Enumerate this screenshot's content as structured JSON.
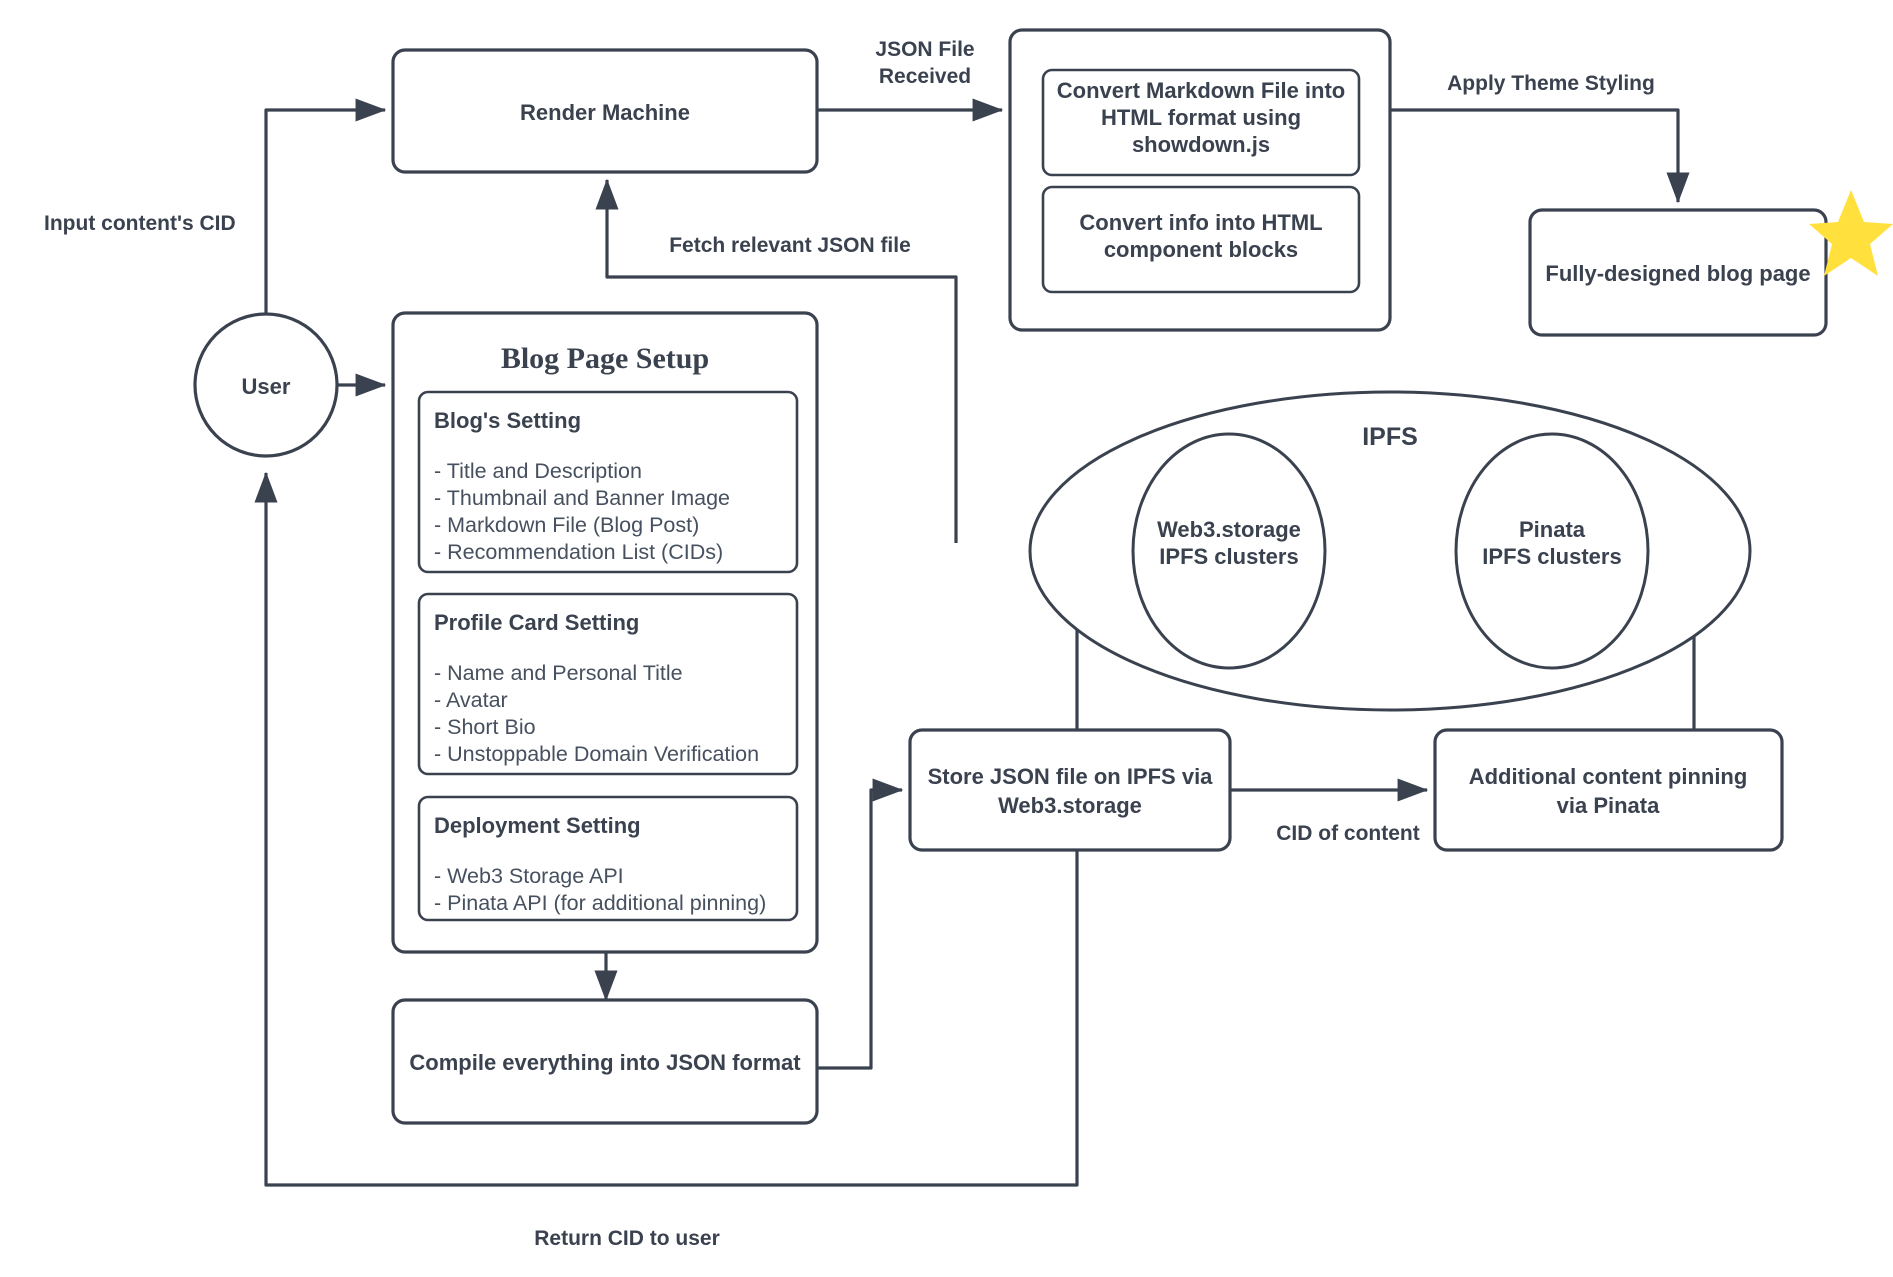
{
  "diagram": {
    "title": "Decentralized blog publishing and rendering flow",
    "colors": {
      "stroke": "#3b424f",
      "text": "#3b424f",
      "list_text": "#47505f",
      "background": "#ffffff",
      "star_accent": "#ffe03d"
    },
    "nodes": {
      "user": {
        "label": "User",
        "shape": "circle"
      },
      "render_machine": {
        "label": "Render Machine",
        "shape": "rounded-rect"
      },
      "convert_group": {
        "shape": "rounded-rect",
        "children": {
          "markdown_convert": {
            "label": "Convert Markdown File into HTML format using showdown.js"
          },
          "info_convert": {
            "label": "Convert info into HTML component blocks"
          }
        }
      },
      "blog_page": {
        "label": "Fully-designed blog page",
        "shape": "rounded-rect",
        "badge": "star-icon"
      },
      "blog_page_setup": {
        "title": "Blog Page Setup",
        "sections": [
          {
            "heading": "Blog's Setting",
            "items": [
              "- Title and Description",
              "- Thumbnail and Banner Image",
              "- Markdown File (Blog Post)",
              "- Recommendation List (CIDs)"
            ]
          },
          {
            "heading": "Profile Card Setting",
            "items": [
              "- Name and Personal Title",
              "- Avatar",
              "- Short Bio",
              "- Unstoppable Domain Verification"
            ]
          },
          {
            "heading": "Deployment Setting",
            "items": [
              "- Web3 Storage API",
              "- Pinata API (for additional pinning)"
            ]
          }
        ]
      },
      "compile_json": {
        "label": "Compile everything into JSON format",
        "shape": "rounded-rect"
      },
      "store_json": {
        "label_line1": "Store JSON file on IPFS via",
        "label_line2": "Web3.storage",
        "shape": "rounded-rect"
      },
      "additional_pinning": {
        "label_line1": "Additional content pinning",
        "label_line2": "via Pinata",
        "shape": "rounded-rect"
      },
      "ipfs": {
        "label": "IPFS",
        "shape": "ellipse",
        "clusters": [
          {
            "label_line1": "Web3.storage",
            "label_line2": "IPFS clusters"
          },
          {
            "label_line1": "Pinata",
            "label_line2": "IPFS clusters"
          }
        ]
      }
    },
    "edge_labels": {
      "input_cid": "Input content's CID",
      "json_file_received_line1": "JSON File",
      "json_file_received_line2": "Received",
      "apply_theme_styling": "Apply Theme Styling",
      "fetch_relevant_json": "Fetch relevant JSON file",
      "cid_of_content": "CID of content",
      "return_cid_to_user": "Return CID to user"
    }
  }
}
